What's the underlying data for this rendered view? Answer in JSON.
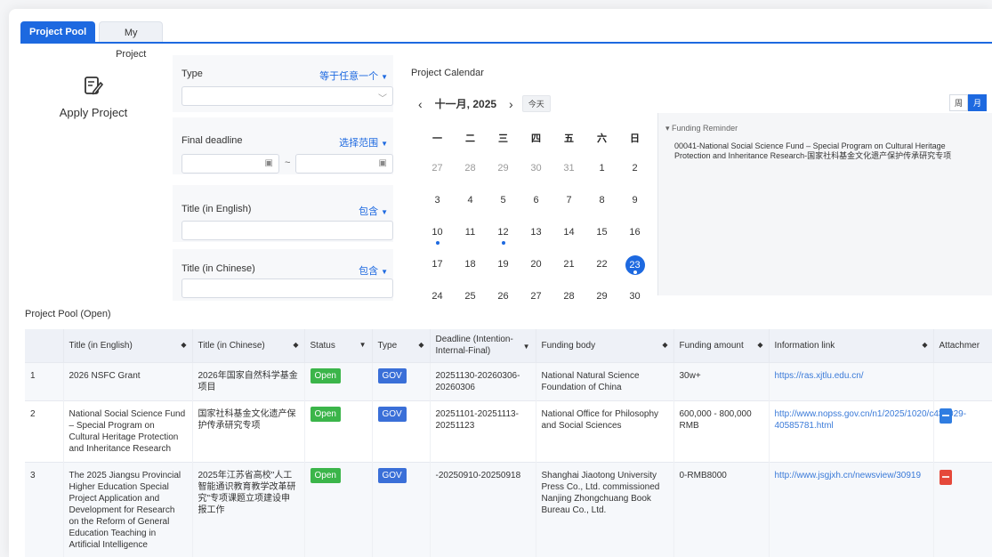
{
  "tabs": [
    {
      "label": "Project Pool",
      "active": true
    },
    {
      "label": "My Project",
      "active": false
    }
  ],
  "apply": {
    "label": "Apply Project",
    "icon": "edit-document-icon"
  },
  "filters": {
    "type": {
      "label": "Type",
      "op": "等于任意一个",
      "value": ""
    },
    "deadline": {
      "label": "Final deadline",
      "op": "选择范围",
      "sep": "~"
    },
    "title_en": {
      "label": "Title (in English)",
      "op": "包含"
    },
    "title_cn": {
      "label": "Title (in Chinese)",
      "op": "包含"
    }
  },
  "calendar": {
    "title": "Project Calendar",
    "month": "十一月, 2025",
    "today_label": "今天",
    "view_week": "周",
    "view_month": "月",
    "weekdays": [
      "一",
      "二",
      "三",
      "四",
      "五",
      "六",
      "日"
    ],
    "weeks": [
      [
        {
          "d": "27",
          "o": true
        },
        {
          "d": "28",
          "o": true
        },
        {
          "d": "29",
          "o": true
        },
        {
          "d": "30",
          "o": true
        },
        {
          "d": "31",
          "o": true
        },
        {
          "d": "1"
        },
        {
          "d": "2"
        }
      ],
      [
        {
          "d": "3"
        },
        {
          "d": "4"
        },
        {
          "d": "5"
        },
        {
          "d": "6"
        },
        {
          "d": "7"
        },
        {
          "d": "8"
        },
        {
          "d": "9"
        }
      ],
      [
        {
          "d": "10",
          "dot": true
        },
        {
          "d": "11"
        },
        {
          "d": "12",
          "dot": true
        },
        {
          "d": "13"
        },
        {
          "d": "14"
        },
        {
          "d": "15"
        },
        {
          "d": "16"
        }
      ],
      [
        {
          "d": "17"
        },
        {
          "d": "18"
        },
        {
          "d": "19"
        },
        {
          "d": "20"
        },
        {
          "d": "21"
        },
        {
          "d": "22"
        },
        {
          "d": "23",
          "today": true
        }
      ],
      [
        {
          "d": "24"
        },
        {
          "d": "25"
        },
        {
          "d": "26"
        },
        {
          "d": "27"
        },
        {
          "d": "28"
        },
        {
          "d": "29"
        },
        {
          "d": "30"
        }
      ]
    ]
  },
  "reminder": {
    "title": "Funding Reminder",
    "text": "00041-National Social Science Fund – Special Program on Cultural Heritage Protection and Inheritance Research-国家社科基金文化遗产保护传承研究专项"
  },
  "pool": {
    "title": "Project Pool (Open)",
    "columns": [
      "",
      "Title (in English)",
      "Title (in Chinese)",
      "Status",
      "Type",
      "Deadline (Intention-Internal-Final)",
      "Funding body",
      "Funding amount",
      "Information link",
      "Attachmer"
    ],
    "rows": [
      {
        "no": "1",
        "title_en": "2026 NSFC Grant",
        "title_cn": "2026年国家自然科学基金项目",
        "status": "Open",
        "type": "GOV",
        "deadline": "20251130-20260306-20260306",
        "body": "National Natural Science Foundation of China",
        "amount": "30w+",
        "link": "https://ras.xjtlu.edu.cn/",
        "attach": ""
      },
      {
        "no": "2",
        "title_en": "National Social Science Fund – Special Program on Cultural Heritage Protection and Inheritance Research",
        "title_cn": "国家社科基金文化遗产保护传承研究专项",
        "status": "Open",
        "type": "GOV",
        "deadline": "20251101-20251113-20251123",
        "body": "National Office for Philosophy and Social Sciences",
        "amount": "600,000 - 800,000 RMB",
        "link": "http://www.nopss.gov.cn/n1/2025/1020/c431029-40585781.html",
        "attach": "doc"
      },
      {
        "no": "3",
        "title_en": "The 2025 Jiangsu Provincial Higher Education Special Project Application and Development for Research on the Reform of General Education Teaching in Artificial Intelligence",
        "title_cn": "2025年江苏省高校\"人工智能通识教育教学改革研究\"专项课题立项建设申报工作",
        "status": "Open",
        "type": "GOV",
        "deadline": "-20250910-20250918",
        "body": "Shanghai Jiaotong University Press Co., Ltd. commissioned Nanjing Zhongchuang Book Bureau Co., Ltd.",
        "amount": "0-RMB8000",
        "link": "http://www.jsgjxh.cn/newsview/30919",
        "attach": "pdf"
      }
    ]
  },
  "colors": {
    "accent": "#1d69e0",
    "open": "#3bb54a",
    "gov": "#3a6fd8"
  }
}
